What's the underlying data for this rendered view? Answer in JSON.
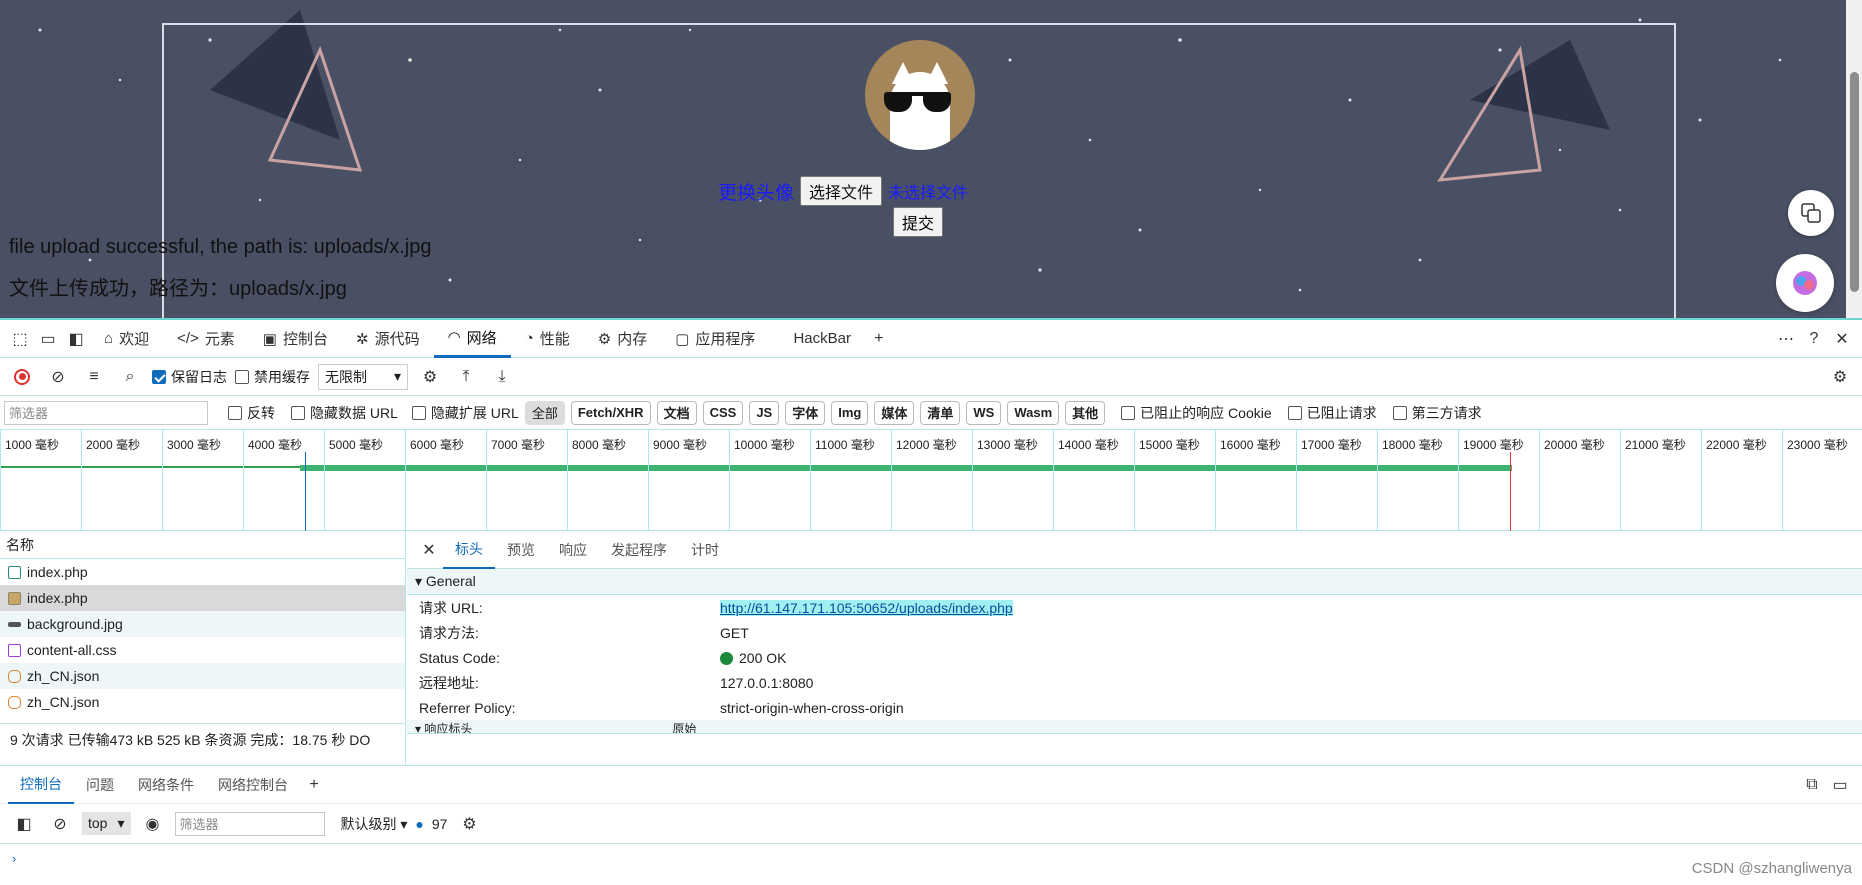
{
  "page": {
    "change_avatar_label": "更换头像",
    "choose_file_label": "选择文件",
    "no_file_label": "未选择文件",
    "submit_label": "提交",
    "message_en": "file upload successful, the path is: uploads/x.jpg",
    "message_cn": "文件上传成功，路径为：uploads/x.jpg",
    "background_color": "#4a5064"
  },
  "devtools": {
    "tabs": [
      {
        "label": "欢迎",
        "icon": "home-icon"
      },
      {
        "label": "元素",
        "icon": "code-icon"
      },
      {
        "label": "控制台",
        "icon": "console-icon"
      },
      {
        "label": "源代码",
        "icon": "bug-icon"
      },
      {
        "label": "网络",
        "icon": "wifi-icon"
      },
      {
        "label": "性能",
        "icon": "gauge-icon"
      },
      {
        "label": "内存",
        "icon": "gear-icon"
      },
      {
        "label": "应用程序",
        "icon": "app-icon"
      },
      {
        "label": "HackBar",
        "icon": ""
      }
    ],
    "active_tab": "网络",
    "toolbar": {
      "preserve_log": "保留日志",
      "disable_cache": "禁用缓存",
      "throttle": "无限制"
    },
    "filter": {
      "placeholder": "筛选器",
      "invert": "反转",
      "hide_data_url": "隐藏数据 URL",
      "hide_ext_url": "隐藏扩展 URL",
      "types": [
        "全部",
        "Fetch/XHR",
        "文档",
        "CSS",
        "JS",
        "字体",
        "Img",
        "媒体",
        "清单",
        "WS",
        "Wasm",
        "其他"
      ],
      "blocked_cookies": "已阻止的响应 Cookie",
      "blocked_requests": "已阻止请求",
      "third_party": "第三方请求"
    },
    "timeline_ticks": [
      "1000 毫秒",
      "2000 毫秒",
      "3000 毫秒",
      "4000 毫秒",
      "5000 毫秒",
      "6000 毫秒",
      "7000 毫秒",
      "8000 毫秒",
      "9000 毫秒",
      "10000 毫秒",
      "11000 毫秒",
      "12000 毫秒",
      "13000 毫秒",
      "14000 毫秒",
      "15000 毫秒",
      "16000 毫秒",
      "17000 毫秒",
      "18000 毫秒",
      "19000 毫秒",
      "20000 毫秒",
      "21000 毫秒",
      "22000 毫秒",
      "23000 毫秒"
    ],
    "requests": {
      "header": "名称",
      "items": [
        "index.php",
        "index.php",
        "background.jpg",
        "content-all.css",
        "zh_CN.json",
        "zh_CN.json"
      ],
      "summary": "9 次请求   已传输473 kB   525 kB 条资源   完成：18.75 秒   DO"
    },
    "detail": {
      "tabs": [
        "标头",
        "预览",
        "响应",
        "发起程序",
        "计时"
      ],
      "section_general": "▾ General",
      "rows": [
        {
          "k": "请求 URL:",
          "v": "http://61.147.171.105:50652/uploads/index.php"
        },
        {
          "k": "请求方法:",
          "v": "GET"
        },
        {
          "k": "Status Code:",
          "v": "200 OK"
        },
        {
          "k": "远程地址:",
          "v": "127.0.0.1:8080"
        },
        {
          "k": "Referrer Policy:",
          "v": "strict-origin-when-cross-origin"
        }
      ],
      "section_response": "▾ 响应标头",
      "raw_label": "原始"
    },
    "drawer": {
      "tabs": [
        "控制台",
        "问题",
        "网络条件",
        "网络控制台"
      ],
      "context": "top",
      "filter_placeholder": "筛选器",
      "level": "默认级别",
      "issues_count": "97"
    }
  },
  "watermark": "CSDN @szhangliwenya"
}
